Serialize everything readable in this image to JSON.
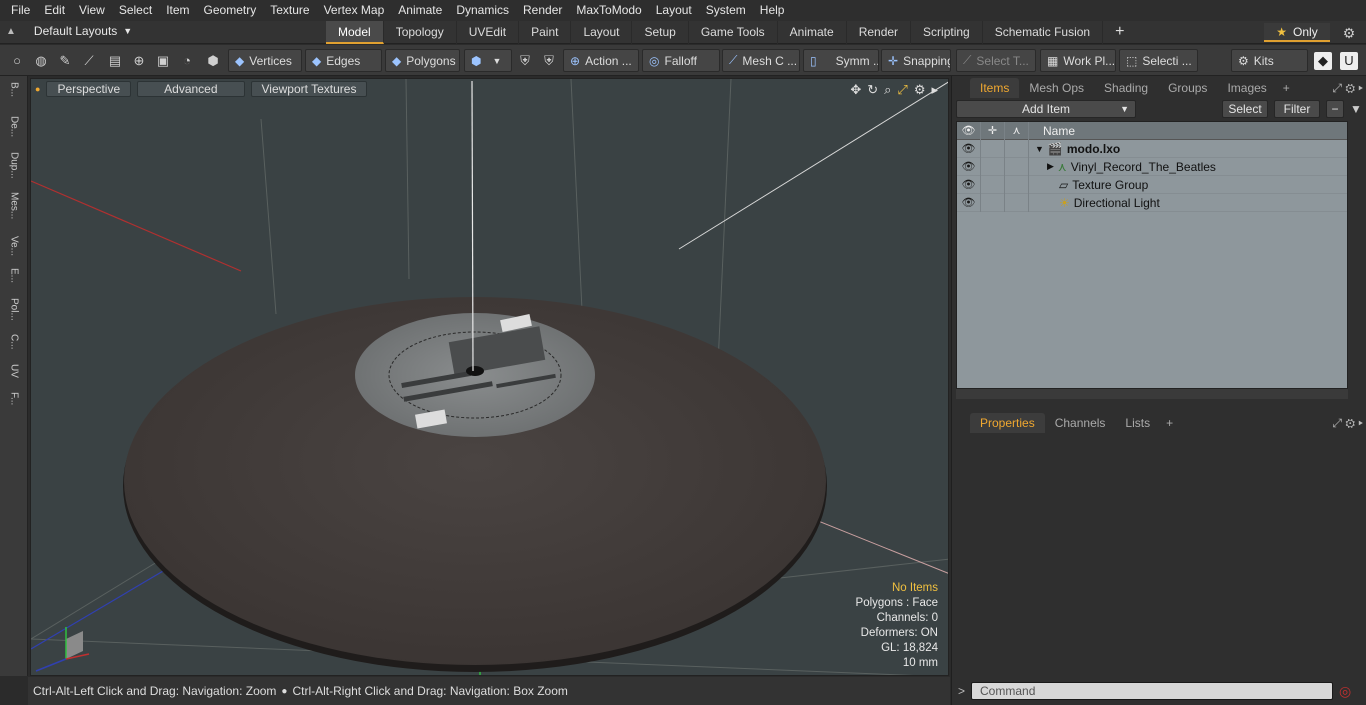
{
  "menu": [
    "File",
    "Edit",
    "View",
    "Select",
    "Item",
    "Geometry",
    "Texture",
    "Vertex Map",
    "Animate",
    "Dynamics",
    "Render",
    "MaxToModo",
    "Layout",
    "System",
    "Help"
  ],
  "layout_selector": "Default Layouts",
  "layout_tabs": [
    {
      "label": "Model",
      "active": true
    },
    {
      "label": "Topology"
    },
    {
      "label": "UVEdit"
    },
    {
      "label": "Paint"
    },
    {
      "label": "Layout"
    },
    {
      "label": "Setup"
    },
    {
      "label": "Game Tools"
    },
    {
      "label": "Animate"
    },
    {
      "label": "Render"
    },
    {
      "label": "Scripting"
    },
    {
      "label": "Schematic Fusion"
    }
  ],
  "only_label": "Only",
  "toolbar": {
    "vertices": "Vertices",
    "edges": "Edges",
    "polygons": "Polygons",
    "action": "Action ...",
    "falloff": "Falloff",
    "mesh": "Mesh C ...",
    "symm": "Symm ...",
    "snapping": "Snapping",
    "select_t": "Select T...",
    "workpl": "Work Pl...",
    "selecti": "Selecti ...",
    "kits": "Kits"
  },
  "left_strip": [
    "B...",
    "De...",
    "Dup...",
    "Mes...",
    "Ve...",
    "E...",
    "Pol...",
    "C...",
    "UV",
    "F..."
  ],
  "viewport": {
    "view_mode": "Perspective",
    "shading": "Advanced",
    "textures": "Viewport Textures",
    "stats": {
      "items": "No Items",
      "polygons": "Polygons : Face",
      "channels": "Channels: 0",
      "deformers": "Deformers: ON",
      "gl": "GL: 18,824",
      "grid": "10 mm"
    }
  },
  "status": {
    "left": "Ctrl-Alt-Left Click and Drag: Navigation: Zoom",
    "right": "Ctrl-Alt-Right Click and Drag: Navigation: Box Zoom"
  },
  "items_panel": {
    "tabs": [
      {
        "label": "Items",
        "active": true
      },
      {
        "label": "Mesh Ops"
      },
      {
        "label": "Shading"
      },
      {
        "label": "Groups"
      },
      {
        "label": "Images"
      }
    ],
    "add_item": "Add Item",
    "select": "Select",
    "filter": "Filter",
    "name_header": "Name",
    "tree": {
      "root": "modo.lxo",
      "mesh": "Vinyl_Record_The_Beatles",
      "texture_group": "Texture Group",
      "light": "Directional Light"
    }
  },
  "props_panel": {
    "tabs": [
      {
        "label": "Properties",
        "active": true
      },
      {
        "label": "Channels"
      },
      {
        "label": "Lists"
      }
    ]
  },
  "command_placeholder": "Command",
  "colors": {
    "accent": "#f0a830",
    "viewport_bg": "#3a4244",
    "tree_bg": "#8e979c"
  }
}
